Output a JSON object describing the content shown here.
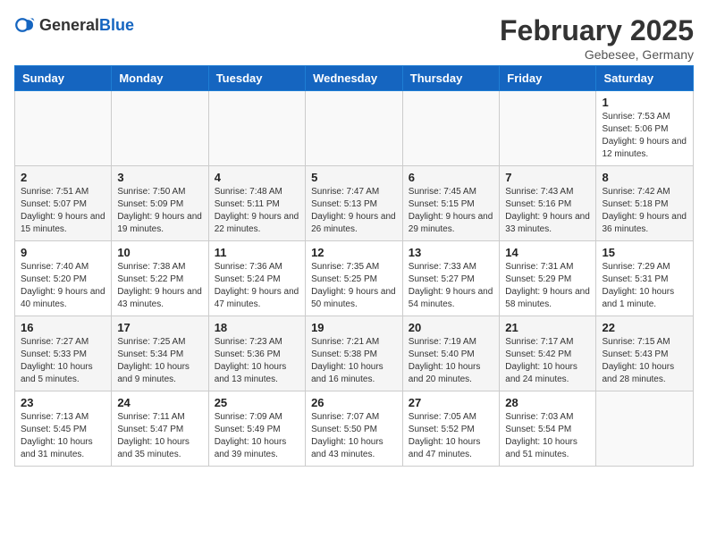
{
  "header": {
    "logo_general": "General",
    "logo_blue": "Blue",
    "month_year": "February 2025",
    "location": "Gebesee, Germany"
  },
  "weekdays": [
    "Sunday",
    "Monday",
    "Tuesday",
    "Wednesday",
    "Thursday",
    "Friday",
    "Saturday"
  ],
  "weeks": [
    [
      {
        "day": "",
        "info": ""
      },
      {
        "day": "",
        "info": ""
      },
      {
        "day": "",
        "info": ""
      },
      {
        "day": "",
        "info": ""
      },
      {
        "day": "",
        "info": ""
      },
      {
        "day": "",
        "info": ""
      },
      {
        "day": "1",
        "info": "Sunrise: 7:53 AM\nSunset: 5:06 PM\nDaylight: 9 hours and 12 minutes."
      }
    ],
    [
      {
        "day": "2",
        "info": "Sunrise: 7:51 AM\nSunset: 5:07 PM\nDaylight: 9 hours and 15 minutes."
      },
      {
        "day": "3",
        "info": "Sunrise: 7:50 AM\nSunset: 5:09 PM\nDaylight: 9 hours and 19 minutes."
      },
      {
        "day": "4",
        "info": "Sunrise: 7:48 AM\nSunset: 5:11 PM\nDaylight: 9 hours and 22 minutes."
      },
      {
        "day": "5",
        "info": "Sunrise: 7:47 AM\nSunset: 5:13 PM\nDaylight: 9 hours and 26 minutes."
      },
      {
        "day": "6",
        "info": "Sunrise: 7:45 AM\nSunset: 5:15 PM\nDaylight: 9 hours and 29 minutes."
      },
      {
        "day": "7",
        "info": "Sunrise: 7:43 AM\nSunset: 5:16 PM\nDaylight: 9 hours and 33 minutes."
      },
      {
        "day": "8",
        "info": "Sunrise: 7:42 AM\nSunset: 5:18 PM\nDaylight: 9 hours and 36 minutes."
      }
    ],
    [
      {
        "day": "9",
        "info": "Sunrise: 7:40 AM\nSunset: 5:20 PM\nDaylight: 9 hours and 40 minutes."
      },
      {
        "day": "10",
        "info": "Sunrise: 7:38 AM\nSunset: 5:22 PM\nDaylight: 9 hours and 43 minutes."
      },
      {
        "day": "11",
        "info": "Sunrise: 7:36 AM\nSunset: 5:24 PM\nDaylight: 9 hours and 47 minutes."
      },
      {
        "day": "12",
        "info": "Sunrise: 7:35 AM\nSunset: 5:25 PM\nDaylight: 9 hours and 50 minutes."
      },
      {
        "day": "13",
        "info": "Sunrise: 7:33 AM\nSunset: 5:27 PM\nDaylight: 9 hours and 54 minutes."
      },
      {
        "day": "14",
        "info": "Sunrise: 7:31 AM\nSunset: 5:29 PM\nDaylight: 9 hours and 58 minutes."
      },
      {
        "day": "15",
        "info": "Sunrise: 7:29 AM\nSunset: 5:31 PM\nDaylight: 10 hours and 1 minute."
      }
    ],
    [
      {
        "day": "16",
        "info": "Sunrise: 7:27 AM\nSunset: 5:33 PM\nDaylight: 10 hours and 5 minutes."
      },
      {
        "day": "17",
        "info": "Sunrise: 7:25 AM\nSunset: 5:34 PM\nDaylight: 10 hours and 9 minutes."
      },
      {
        "day": "18",
        "info": "Sunrise: 7:23 AM\nSunset: 5:36 PM\nDaylight: 10 hours and 13 minutes."
      },
      {
        "day": "19",
        "info": "Sunrise: 7:21 AM\nSunset: 5:38 PM\nDaylight: 10 hours and 16 minutes."
      },
      {
        "day": "20",
        "info": "Sunrise: 7:19 AM\nSunset: 5:40 PM\nDaylight: 10 hours and 20 minutes."
      },
      {
        "day": "21",
        "info": "Sunrise: 7:17 AM\nSunset: 5:42 PM\nDaylight: 10 hours and 24 minutes."
      },
      {
        "day": "22",
        "info": "Sunrise: 7:15 AM\nSunset: 5:43 PM\nDaylight: 10 hours and 28 minutes."
      }
    ],
    [
      {
        "day": "23",
        "info": "Sunrise: 7:13 AM\nSunset: 5:45 PM\nDaylight: 10 hours and 31 minutes."
      },
      {
        "day": "24",
        "info": "Sunrise: 7:11 AM\nSunset: 5:47 PM\nDaylight: 10 hours and 35 minutes."
      },
      {
        "day": "25",
        "info": "Sunrise: 7:09 AM\nSunset: 5:49 PM\nDaylight: 10 hours and 39 minutes."
      },
      {
        "day": "26",
        "info": "Sunrise: 7:07 AM\nSunset: 5:50 PM\nDaylight: 10 hours and 43 minutes."
      },
      {
        "day": "27",
        "info": "Sunrise: 7:05 AM\nSunset: 5:52 PM\nDaylight: 10 hours and 47 minutes."
      },
      {
        "day": "28",
        "info": "Sunrise: 7:03 AM\nSunset: 5:54 PM\nDaylight: 10 hours and 51 minutes."
      },
      {
        "day": "",
        "info": ""
      }
    ]
  ]
}
